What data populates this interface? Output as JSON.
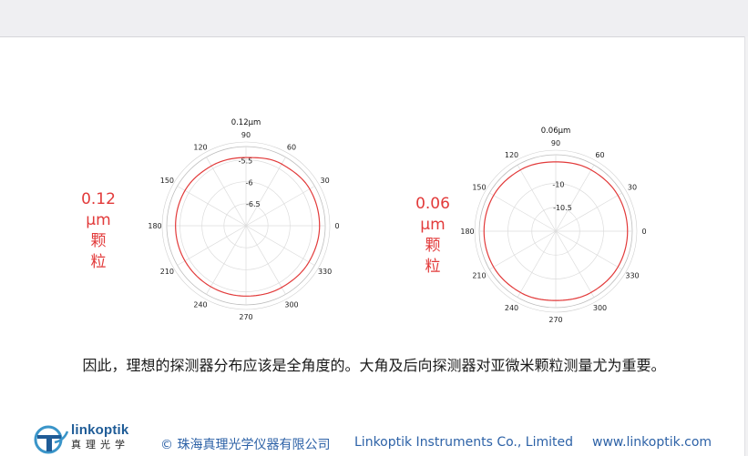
{
  "side_labels": [
    {
      "lines": [
        "0.12",
        "μm",
        "颗",
        "粒"
      ]
    },
    {
      "lines": [
        "0.06",
        "μm",
        "颗",
        "粒"
      ]
    }
  ],
  "caption": "因此，理想的探测器分布应该是全角度的。大角及后向探测器对亚微米颗粒测量尤为重要。",
  "footer": {
    "brand_name": "linkoptik",
    "brand_cn": "真理光学",
    "copyright": "© 珠海真理光学仪器有限公司",
    "company_en": "Linkoptik Instruments Co., Limited",
    "website": "www.linkoptik.com"
  },
  "colors": {
    "curve": "#e23a3a",
    "brand": "#1f5c97",
    "footer_text": "#2d62a7"
  },
  "chart_data": [
    {
      "type": "polar",
      "title": "0.12μm",
      "angle_ticks": [
        0,
        30,
        60,
        90,
        120,
        150,
        180,
        210,
        240,
        270,
        300,
        330
      ],
      "radial_ticks": [
        "-6.5",
        "-6",
        "-5.5"
      ],
      "r_min": -7,
      "r_max": -5.2,
      "series": [
        {
          "theta": [
            0,
            30,
            60,
            90,
            120,
            150,
            180,
            210,
            240,
            270,
            300,
            330,
            360
          ],
          "r": [
            -5.33,
            -5.33,
            -5.38,
            -5.45,
            -5.43,
            -5.4,
            -5.4,
            -5.4,
            -5.4,
            -5.4,
            -5.38,
            -5.35,
            -5.33
          ]
        }
      ]
    },
    {
      "type": "polar",
      "title": "0.06μm",
      "angle_ticks": [
        0,
        30,
        60,
        90,
        120,
        150,
        180,
        210,
        240,
        270,
        300,
        330
      ],
      "radial_ticks": [
        "-10.5",
        "-10"
      ],
      "r_min": -11,
      "r_max": -9.4,
      "series": [
        {
          "theta": [
            0,
            30,
            60,
            90,
            120,
            150,
            180,
            210,
            240,
            270,
            300,
            330,
            360
          ],
          "r": [
            -9.5,
            -9.5,
            -9.52,
            -9.55,
            -9.52,
            -9.5,
            -9.5,
            -9.5,
            -9.52,
            -9.55,
            -9.52,
            -9.5,
            -9.5
          ]
        }
      ]
    }
  ]
}
